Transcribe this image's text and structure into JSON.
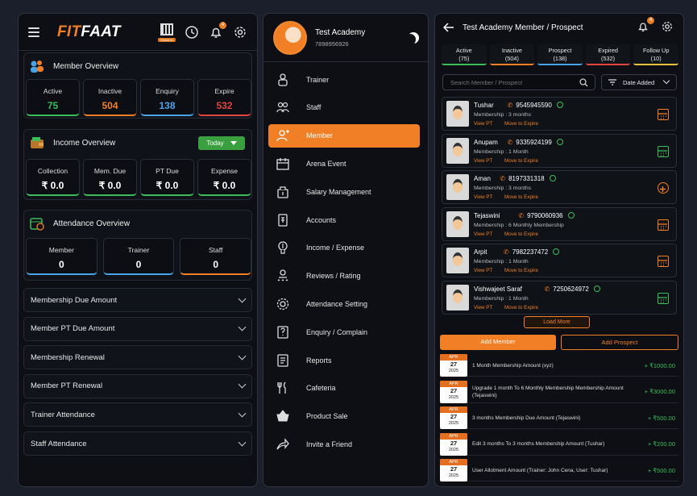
{
  "left": {
    "logo_a": "FIT",
    "logo_b": "FAAT",
    "qr_tag": "Check in",
    "notif_count": "4",
    "member_overview": {
      "title": "Member Overview",
      "stats": [
        {
          "label": "Active",
          "value": "75",
          "color": "#3bbd5a"
        },
        {
          "label": "Inactive",
          "value": "504",
          "color": "#f07f25"
        },
        {
          "label": "Enquiry",
          "value": "138",
          "color": "#4aa3e6"
        },
        {
          "label": "Expire",
          "value": "532",
          "color": "#e0463e"
        }
      ]
    },
    "income_overview": {
      "title": "Income Overview",
      "filter": "Today",
      "stats": [
        {
          "label": "Collection",
          "value": "₹ 0.0",
          "color": "#3bbd5a"
        },
        {
          "label": "Mem. Due",
          "value": "₹ 0.0",
          "color": "#3bbd5a"
        },
        {
          "label": "PT Due",
          "value": "₹ 0.0",
          "color": "#3bbd5a"
        },
        {
          "label": "Expense",
          "value": "₹ 0.0",
          "color": "#3bbd5a"
        }
      ]
    },
    "attendance_overview": {
      "title": "Attendance Overview",
      "stats": [
        {
          "label": "Member",
          "value": "0",
          "color": "#4aa3e6"
        },
        {
          "label": "Trainer",
          "value": "0",
          "color": "#4aa3e6"
        },
        {
          "label": "Staff",
          "value": "0",
          "color": "#f07f25"
        }
      ]
    },
    "accordions": [
      "Membership Due Amount",
      "Member PT Due Amount",
      "Membership Renewal",
      "Member PT Renewal",
      "Trainer Attendance",
      "Staff Attendance"
    ]
  },
  "middle": {
    "name": "Test Academy",
    "phone": "7898956926",
    "menu": [
      {
        "label": "Trainer",
        "icon": "trainer-icon"
      },
      {
        "label": "Staff",
        "icon": "staff-icon"
      },
      {
        "label": "Member",
        "icon": "member-icon",
        "active": true
      },
      {
        "label": "Arena Event",
        "icon": "arena-event-icon"
      },
      {
        "label": "Salary Management",
        "icon": "salary-icon"
      },
      {
        "label": "Accounts",
        "icon": "accounts-icon"
      },
      {
        "label": "Income / Expense",
        "icon": "income-expense-icon"
      },
      {
        "label": "Reviews / Rating",
        "icon": "reviews-icon"
      },
      {
        "label": "Attendance Setting",
        "icon": "attendance-setting-icon"
      },
      {
        "label": "Enquiry / Complain",
        "icon": "enquiry-icon"
      },
      {
        "label": "Reports",
        "icon": "reports-icon"
      },
      {
        "label": "Cafeteria",
        "icon": "cafeteria-icon"
      },
      {
        "label": "Product Sale",
        "icon": "product-sale-icon"
      },
      {
        "label": "Invite a Friend",
        "icon": "invite-icon"
      }
    ]
  },
  "right": {
    "title": "Test Academy Member / Prospect",
    "notif_count": "4",
    "tabs": [
      {
        "label": "Active",
        "count": "(75)",
        "color": "#3bbd5a"
      },
      {
        "label": "Inactive",
        "count": "(504)",
        "color": "#f07f25"
      },
      {
        "label": "Prospect",
        "count": "(138)",
        "color": "#4aa3e6"
      },
      {
        "label": "Expired",
        "count": "(532)",
        "color": "#e0463e"
      },
      {
        "label": "Follow Up",
        "count": "(10)",
        "color": "#e6c23a"
      }
    ],
    "search_placeholder": "Search Member / Prospect",
    "sort_label": "Date Added",
    "members": [
      {
        "name": "Tushar",
        "phone": "9545945590",
        "membership": "Membership  :  3 months",
        "view": "View PT",
        "move": "Move to Expire",
        "action_color": "#f07f25",
        "action": "calendar-icon"
      },
      {
        "name": "Anupam",
        "phone": "9335924199",
        "membership": "Membership  : 1 Month",
        "view": "View PT",
        "move": "Move to Expire",
        "action_color": "#3bbd5a",
        "action": "calendar-icon"
      },
      {
        "name": "Aman",
        "phone": "8197331318",
        "membership": "Membership  :  3 months",
        "view": "View PT",
        "move": "Move to Expire",
        "action_color": "#f07f25",
        "action": "plus-icon"
      },
      {
        "name": "Tejaswini",
        "phone": "9790060936",
        "membership": "Membership  :  6 Monthly Membership",
        "view": "View PT",
        "move": "Move to Expire",
        "action_color": "#f07f25",
        "action": "calendar-icon"
      },
      {
        "name": "Arpit",
        "phone": "7982237472",
        "membership": "Membership  :  1 Month",
        "view": "View PT",
        "move": "Move to Expire",
        "action_color": "#f07f25",
        "action": "calendar-icon"
      },
      {
        "name": "Vishwajeet Saraf",
        "phone": "7250624972",
        "membership": "Membership  :  1 Month",
        "view": "View PT",
        "move": "Move to Expire",
        "action_color": "#3bbd5a",
        "action": "calendar-icon"
      }
    ],
    "load_more": "Load More",
    "add_member": "Add Member",
    "add_prospect": "Add Prospect",
    "transactions": [
      {
        "month": "APR",
        "day": "27",
        "year": "2025",
        "desc": "1 Month Membership Amount (xyz)",
        "amount": "+ ₹1000.00"
      },
      {
        "month": "APR",
        "day": "27",
        "year": "2025",
        "desc": "Upgrade  1  month  To  6  Monthly  Membership Membership Amount (Tejaswini)",
        "amount": "+ ₹3000.00"
      },
      {
        "month": "APR",
        "day": "27",
        "year": "2025",
        "desc": "3 months Membership Due Amount (Tejaswini)",
        "amount": "+ ₹500.00"
      },
      {
        "month": "APR",
        "day": "27",
        "year": "2025",
        "desc": "Edit 3 months To 3 months Membership Amount (Tushar)",
        "amount": "+ ₹200.00"
      },
      {
        "month": "APR",
        "day": "27",
        "year": "2025",
        "desc": "User Allotment Amount (Trainer: John Cena, User: Tushar)",
        "amount": "+ ₹500.00"
      }
    ]
  }
}
